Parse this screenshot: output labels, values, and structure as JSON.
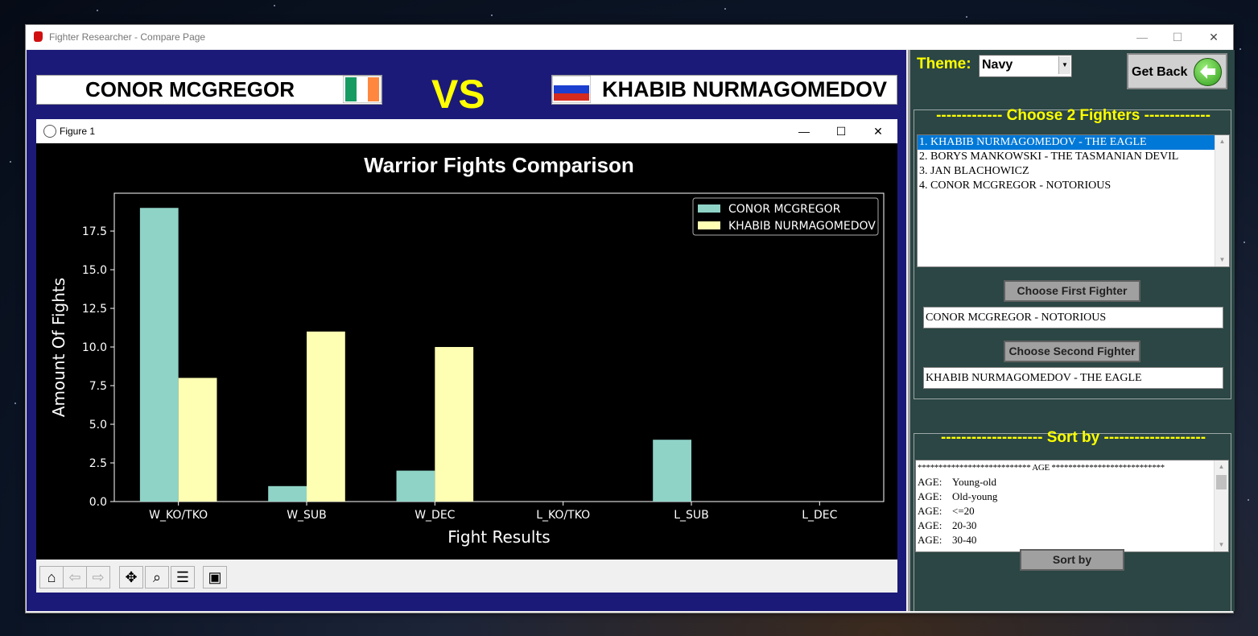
{
  "window": {
    "title": "Fighter Researcher - Compare Page",
    "minimize": "—",
    "maximize": "☐",
    "close": "✕"
  },
  "header": {
    "fighter_left": "CONOR MCGREGOR",
    "fighter_right": "KHABIB NURMAGOMEDOV",
    "vs": "VS",
    "flag_left": "ireland-flag-icon",
    "flag_right": "russia-flag-icon"
  },
  "figure": {
    "title": "Figure 1",
    "toolbar": [
      "home-icon",
      "back-icon",
      "forward-icon",
      "pan-icon",
      "zoom-icon",
      "configure-icon",
      "save-icon"
    ]
  },
  "chart_data": {
    "type": "bar",
    "title": "Warrior Fights Comparison",
    "xlabel": "Fight Results",
    "ylabel": "Amount Of Fights",
    "categories": [
      "W_KO/TKO",
      "W_SUB",
      "W_DEC",
      "L_KO/TKO",
      "L_SUB",
      "L_DEC"
    ],
    "series": [
      {
        "name": "CONOR MCGREGOR",
        "values": [
          19,
          1,
          2,
          0,
          4,
          0
        ],
        "color": "#8fd3c7"
      },
      {
        "name": "KHABIB NURMAGOMEDOV",
        "values": [
          8,
          11,
          10,
          0,
          0,
          0
        ],
        "color": "#ffffb3"
      }
    ],
    "yticks": [
      "0.0",
      "2.5",
      "5.0",
      "7.5",
      "10.0",
      "12.5",
      "15.0",
      "17.5"
    ],
    "ylim": [
      0,
      19.95
    ],
    "legend_position": "top-right",
    "grid": false,
    "background": "#000000"
  },
  "right_panel": {
    "theme_label": "Theme:",
    "theme_value": "Navy",
    "get_back_label": "Get Back",
    "choose_title": "------------- Choose 2 Fighters -------------",
    "fighters": [
      "1. KHABIB NURMAGOMEDOV  -  THE EAGLE",
      "2. BORYS MANKOWSKI  -  THE TASMANIAN DEVIL",
      "3. JAN BLACHOWICZ",
      "4. CONOR MCGREGOR  -  NOTORIOUS"
    ],
    "choose_first_label": "Choose First Fighter",
    "first_value": "CONOR MCGREGOR  -  NOTORIOUS",
    "choose_second_label": "Choose Second Fighter",
    "second_value": "KHABIB NURMAGOMEDOV  -  THE EAGLE",
    "sort_title": "-------------------- Sort by --------------------",
    "sort_header": "***************************  AGE  ***************************",
    "sort_options": [
      {
        "key": "AGE:",
        "value": "Young-old"
      },
      {
        "key": "AGE:",
        "value": "Old-young"
      },
      {
        "key": "AGE:",
        "value": "<=20"
      },
      {
        "key": "AGE:",
        "value": "20-30"
      },
      {
        "key": "AGE:",
        "value": "30-40"
      }
    ],
    "sort_button_label": "Sort by"
  }
}
